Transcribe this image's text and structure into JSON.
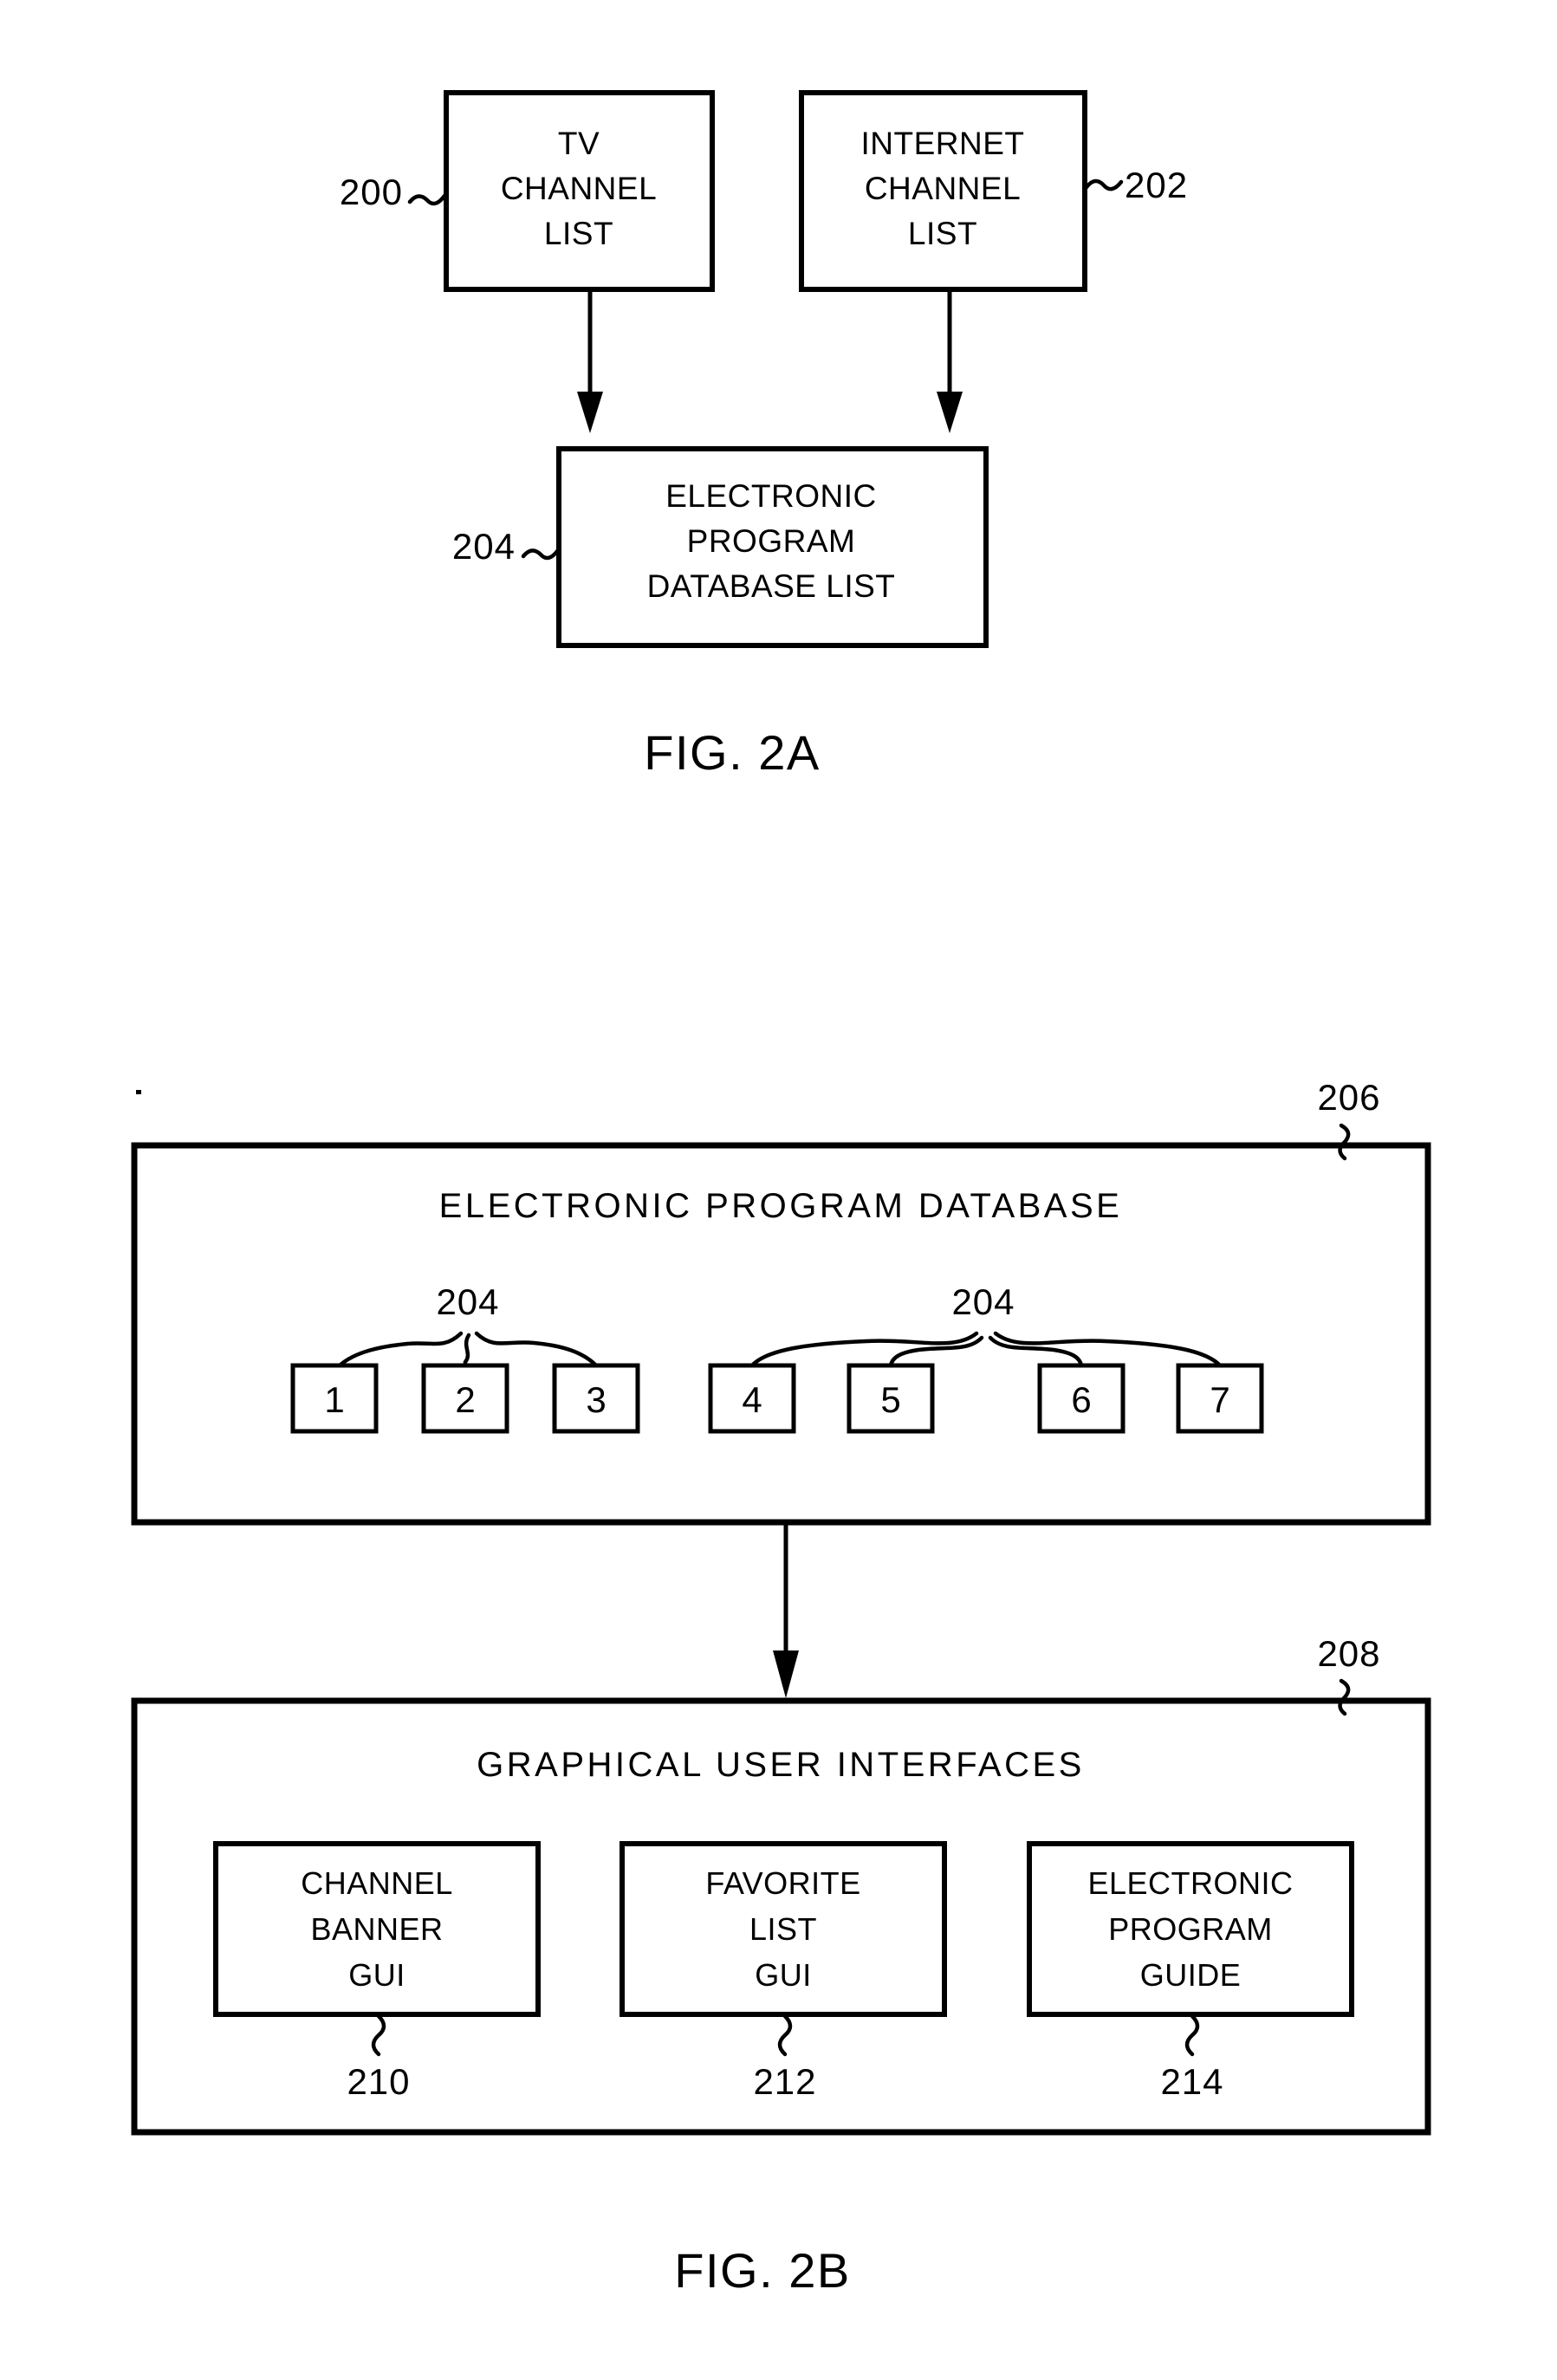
{
  "figures": [
    {
      "id": "fig-2a",
      "caption": "FIG.  2A",
      "boxes": [
        {
          "ref": "200",
          "lines": [
            "TV",
            "CHANNEL",
            "LIST"
          ]
        },
        {
          "ref": "202",
          "lines": [
            "INTERNET",
            "CHANNEL",
            "LIST"
          ]
        },
        {
          "ref": "204",
          "lines": [
            "ELECTRONIC",
            "PROGRAM",
            "DATABASE  LIST"
          ]
        }
      ]
    },
    {
      "id": "fig-2b",
      "caption": "FIG.  2B",
      "database_panel": {
        "ref": "206",
        "title": "ELECTRONIC  PROGRAM  DATABASE",
        "group_ref_left": "204",
        "group_ref_right": "204",
        "cells": [
          "1",
          "2",
          "3",
          "4",
          "5",
          "6",
          "7"
        ]
      },
      "gui_panel": {
        "ref": "208",
        "title": "GRAPHICAL  USER  INTERFACES",
        "items": [
          {
            "ref": "210",
            "lines": [
              "CHANNEL",
              "BANNER",
              "GUI"
            ]
          },
          {
            "ref": "212",
            "lines": [
              "FAVORITE",
              "LIST",
              "GUI"
            ]
          },
          {
            "ref": "214",
            "lines": [
              "ELECTRONIC",
              "PROGRAM",
              "GUIDE"
            ]
          }
        ]
      }
    }
  ],
  "colors": {
    "ink": "#000000",
    "paper": "#ffffff"
  }
}
